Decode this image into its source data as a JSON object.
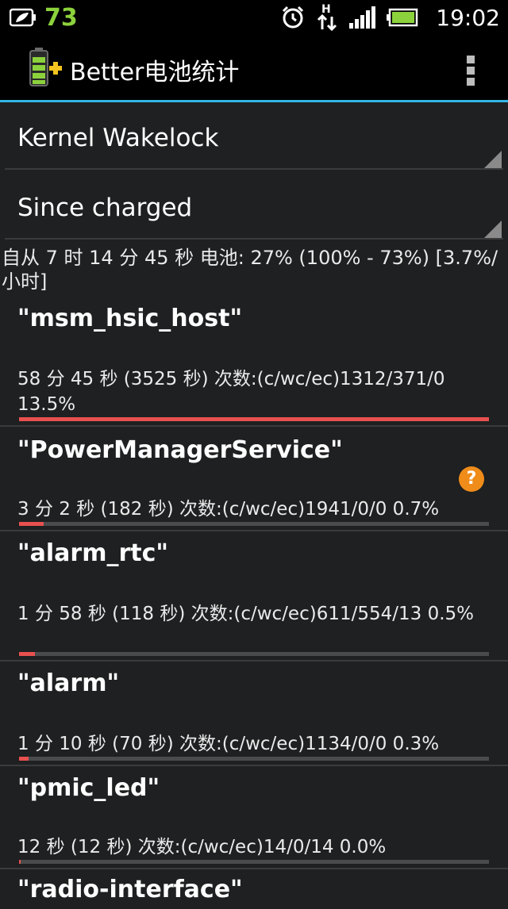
{
  "status_bar": {
    "battery_level": "73",
    "time": "19:02",
    "icons": [
      "leaf-battery-icon",
      "alarm-icon",
      "hspa-data-icon",
      "signal-icon",
      "battery-icon"
    ]
  },
  "action_bar": {
    "title": "Better电池统计",
    "icon": "app-battery-plus-icon",
    "overflow_icon": "overflow-menu-icon"
  },
  "spinners": {
    "stat_type": "Kernel Wakelock",
    "since": "Since charged"
  },
  "summary": "自从 7 时 14 分 45 秒 电池: 27% (100% - 73%) [3.7%/小时]",
  "items": [
    {
      "name": "\"msm_hsic_host\"",
      "stats": "58 分 45 秒  (3525 秒) 次数:(c/wc/ec)1312/371/0 13.5%",
      "fraction": 1.0
    },
    {
      "name": "\"PowerManagerService\"",
      "stats": "3 分 2 秒  (182 秒) 次数:(c/wc/ec)1941/0/0 0.7%",
      "fraction": 0.052
    },
    {
      "name": "\"alarm_rtc\"",
      "stats": "1 分 58 秒  (118 秒) 次数:(c/wc/ec)611/554/13 0.5%",
      "fraction": 0.034
    },
    {
      "name": "\"alarm\"",
      "stats": "1 分 10 秒  (70 秒) 次数:(c/wc/ec)1134/0/0 0.3%",
      "fraction": 0.02
    },
    {
      "name": "\"pmic_led\"",
      "stats": "12 秒  (12 秒) 次数:(c/wc/ec)14/0/14 0.0%",
      "fraction": 0.004
    },
    {
      "name": "\"radio-interface\"",
      "stats": "",
      "fraction": 0
    }
  ],
  "help_badge": "?",
  "colors": {
    "accent": "#33b5e5",
    "bar_fill": "#e85050",
    "bar_track": "#4a4b4d",
    "help": "#f08c1a",
    "battery_green": "#8cd23c"
  }
}
